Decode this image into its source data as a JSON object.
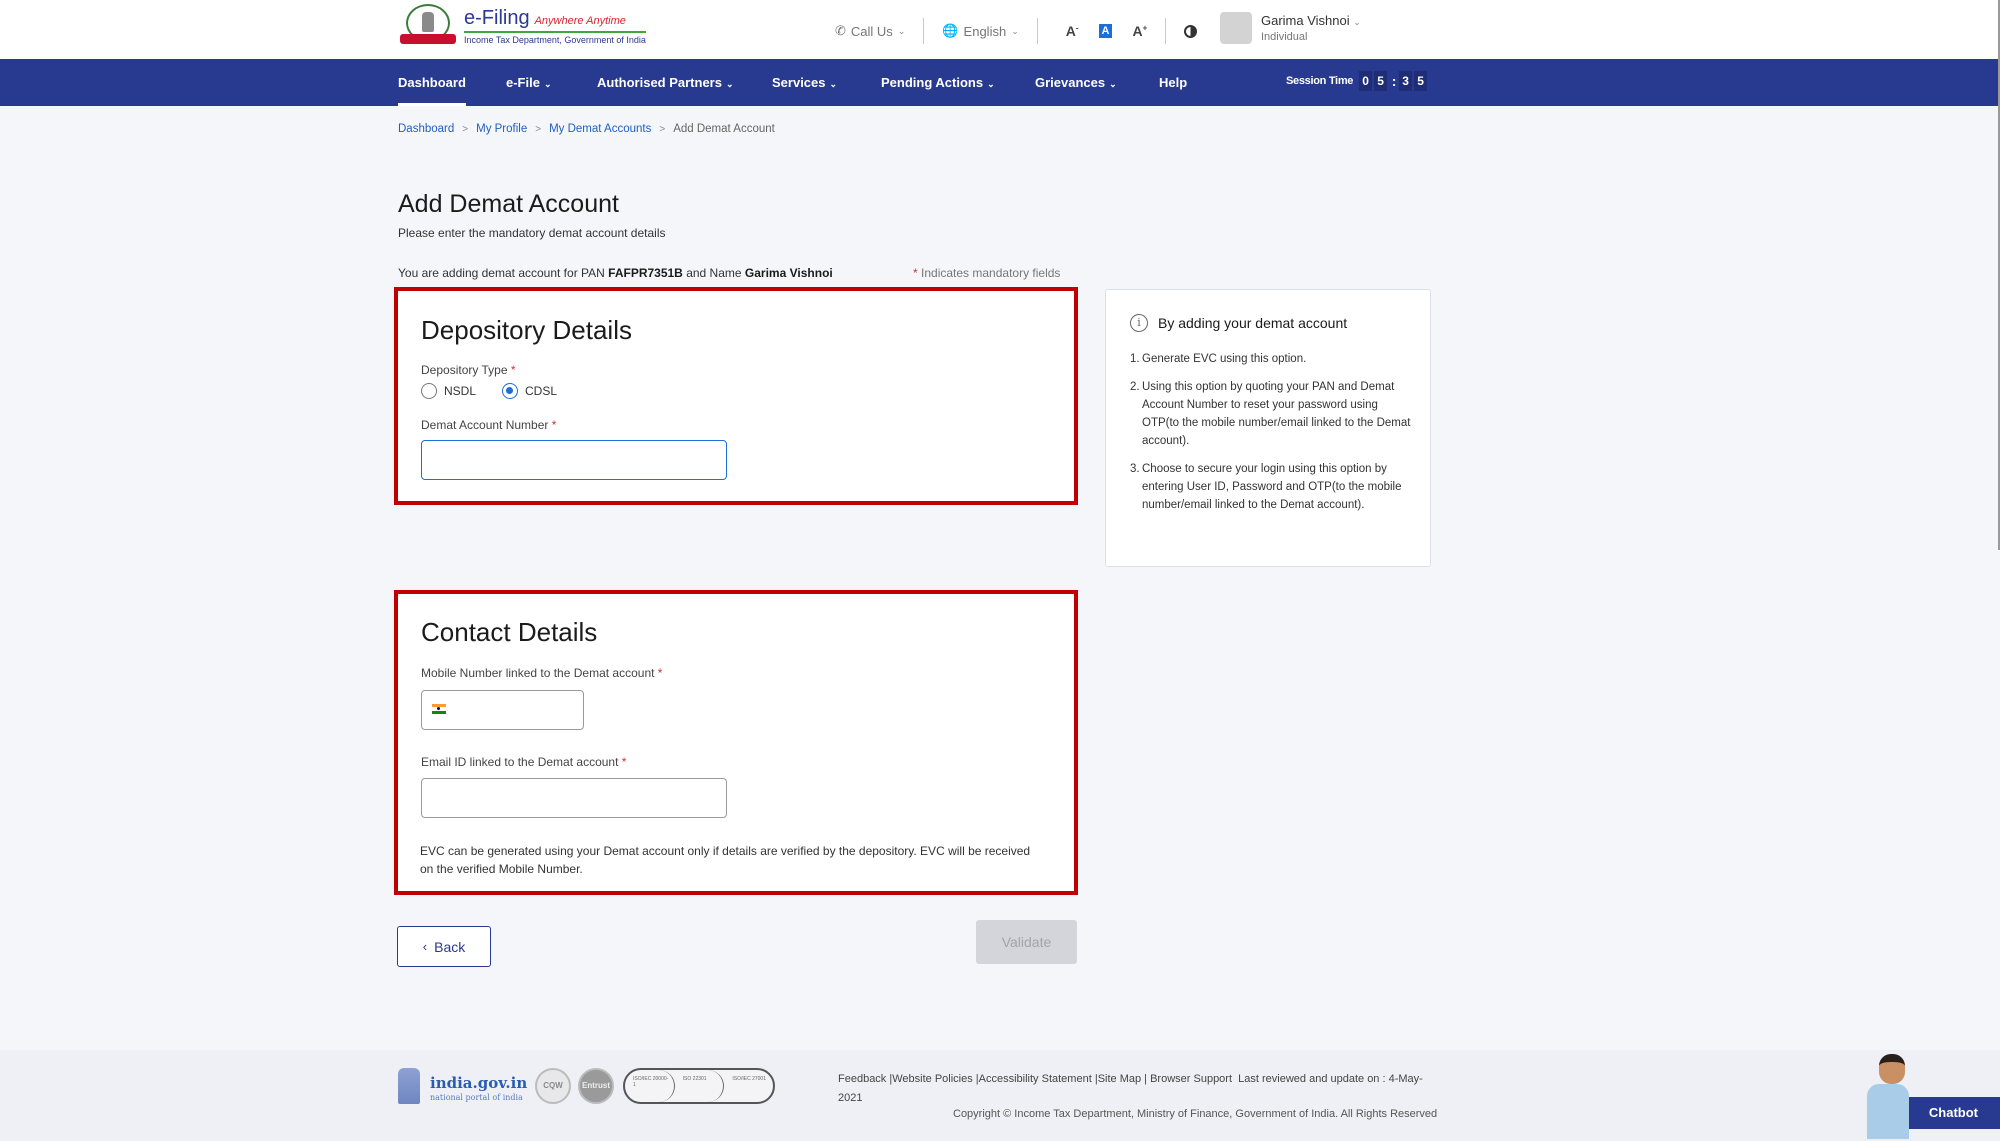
{
  "header": {
    "logo": {
      "title": "e-Filing",
      "tagline": "Anywhere Anytime",
      "subtitle": "Income Tax Department, Government of India"
    },
    "call_us": "Call Us",
    "language": "English",
    "font_decrease": "A-",
    "font_default": "A",
    "font_increase": "A+",
    "user": {
      "name": "Garima Vishnoi",
      "role": "Individual"
    }
  },
  "nav": {
    "items": [
      {
        "label": "Dashboard",
        "active": true,
        "dropdown": false
      },
      {
        "label": "e-File",
        "dropdown": true
      },
      {
        "label": "Authorised Partners",
        "dropdown": true
      },
      {
        "label": "Services",
        "dropdown": true
      },
      {
        "label": "Pending Actions",
        "dropdown": true
      },
      {
        "label": "Grievances",
        "dropdown": true
      },
      {
        "label": "Help",
        "dropdown": false
      }
    ],
    "session_label": "Session Time",
    "session_digits": [
      "0",
      "5",
      "3",
      "5"
    ]
  },
  "breadcrumb": {
    "items": [
      "Dashboard",
      "My Profile",
      "My Demat Accounts"
    ],
    "current": "Add Demat Account"
  },
  "page": {
    "title": "Add Demat Account",
    "subtitle": "Please enter the mandatory demat account details",
    "pan_prefix": "You are adding demat account for PAN",
    "pan": "FAFPR7351B",
    "name_prefix": "and Name",
    "name": "Garima Vishnoi",
    "mandatory_note": "Indicates mandatory fields"
  },
  "depository": {
    "heading": "Depository Details",
    "type_label": "Depository Type",
    "options": [
      {
        "label": "NSDL",
        "selected": false
      },
      {
        "label": "CDSL",
        "selected": true
      }
    ],
    "account_label": "Demat Account Number",
    "account_value": ""
  },
  "contact": {
    "heading": "Contact Details",
    "mobile_label": "Mobile Number linked to the Demat account",
    "mobile_value": "",
    "email_label": "Email ID linked to the Demat account",
    "email_value": "",
    "note": "EVC can be generated using your Demat account only if details are verified by the depository. EVC will be received on the verified Mobile Number."
  },
  "info": {
    "heading": "By adding your demat account",
    "items": [
      "Generate EVC using this option.",
      "Using this option by quoting your PAN and Demat Account Number to reset your password using OTP(to the mobile number/email linked to the Demat account).",
      "Choose to secure your login using this option by entering User ID, Password and OTP(to the mobile number/email linked to the Demat account)."
    ]
  },
  "actions": {
    "back": "Back",
    "validate": "Validate"
  },
  "footer": {
    "gov_name": "india.gov.in",
    "gov_sub": "national portal of india",
    "badges": [
      "CQW",
      "Entrust"
    ],
    "iso_badges": [
      "ISO/IEC 20000-1",
      "ISO 22301",
      "ISO/IEC 27001"
    ],
    "links": [
      "Feedback",
      "Website Policies",
      "Accessibility Statement",
      "Site Map",
      "Browser Support"
    ],
    "last_reviewed": "Last reviewed and update on : 4-May-2021",
    "copyright": "Copyright © Income Tax Department, Ministry of Finance, Government of India. All Rights Reserved"
  },
  "chatbot": {
    "label": "Chatbot"
  },
  "colors": {
    "brand_blue": "#283a8f",
    "highlight_red": "#c00000",
    "link_blue": "#1f5fbf",
    "radio_blue": "#1d6ed8"
  }
}
